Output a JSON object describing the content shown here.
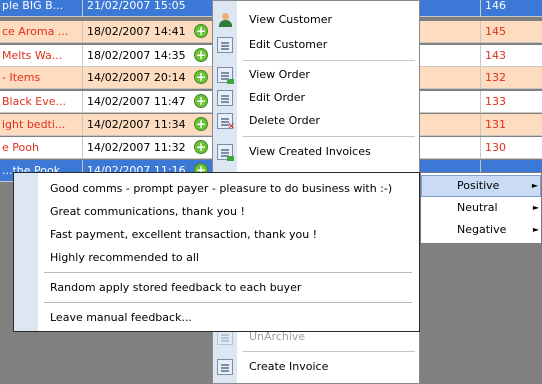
{
  "grid": {
    "rows": [
      {
        "title": "ple BIG B...",
        "date": "21/02/2007 15:05",
        "tail": "146",
        "state": "selected"
      },
      {
        "title": "ce Aroma ...",
        "date": "18/02/2007 14:41",
        "tail": "145",
        "state": "alt"
      },
      {
        "title": "Melts Wa...",
        "date": "18/02/2007 14:35",
        "tail": "143",
        "state": "white"
      },
      {
        "title": "- Items",
        "date": "14/02/2007 20:14",
        "tail": "132",
        "state": "alt"
      },
      {
        "title": "Black Eve...",
        "date": "14/02/2007 11:47",
        "tail": "133",
        "state": "white"
      },
      {
        "title": "ight bedti...",
        "date": "14/02/2007 11:34",
        "tail": "131",
        "state": "alt"
      },
      {
        "title": "e Pooh",
        "date": "14/02/2007 11:32",
        "tail": "130",
        "state": "white"
      },
      {
        "title": "...the Pook",
        "date": "14/02/2007 11:16",
        "tail": "",
        "state": "selected"
      }
    ],
    "expand_glyph": "+"
  },
  "menu": {
    "items": [
      {
        "label": "View Customer",
        "icon": "view-customer-icon"
      },
      {
        "label": "Edit Customer",
        "icon": "edit-customer-icon"
      },
      {
        "label": "View Order",
        "icon": "view-order-icon"
      },
      {
        "label": "Edit Order",
        "icon": "edit-order-icon"
      },
      {
        "label": "Delete Order",
        "icon": "delete-order-icon"
      },
      {
        "label": "View Created Invoices",
        "icon": "view-invoices-icon"
      },
      {
        "label": "UnArchive",
        "icon": "unarchive-icon",
        "disabled": true
      },
      {
        "label": "Create Invoice",
        "icon": "create-invoice-icon"
      }
    ]
  },
  "rating_submenu": {
    "items": [
      {
        "label": "Positive",
        "highlighted": true
      },
      {
        "label": "Neutral"
      },
      {
        "label": "Negative"
      }
    ],
    "arrow_glyph": "►"
  },
  "feedback_submenu": {
    "items": [
      "Good comms - prompt payer - pleasure to do business with :-)",
      "Great communications, thank you !",
      "Fast payment, excellent transaction, thank you !",
      "Highly recommended to all"
    ],
    "random_label": "Random apply stored feedback to each buyer",
    "manual_label": "Leave manual feedback..."
  },
  "colors": {
    "row_alt": "#fddcc0",
    "row_selected": "#3c79d6",
    "title_text": "#e0301e",
    "menu_strip": "#dde7f4",
    "highlight": "#c9dcf4"
  }
}
